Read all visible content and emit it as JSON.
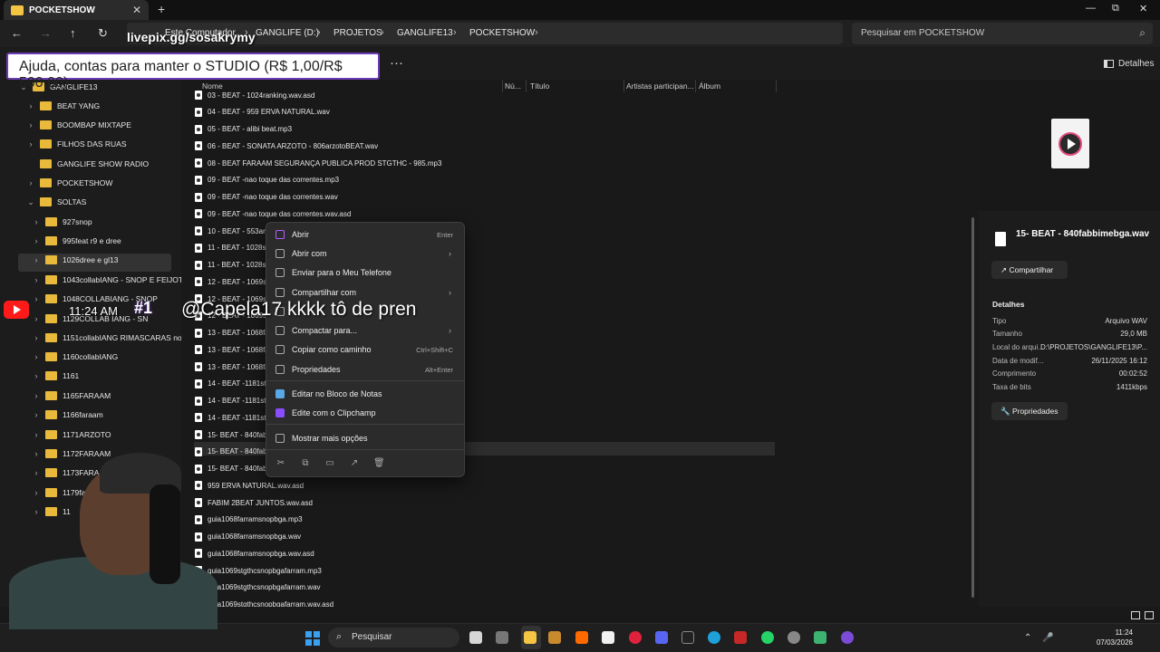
{
  "window": {
    "tab_title": "POCKETSHOW",
    "tab_close": "✕",
    "new_tab": "+",
    "minimize": "—",
    "maximize": "⧉",
    "close": "✕"
  },
  "nav": {
    "back": "←",
    "forward": "→",
    "up": "↑",
    "refresh": "↻"
  },
  "breadcrumbs": [
    "Este Computador",
    "GANGLIFE (D:)",
    "PROJETOS",
    "GANGLIFE13",
    "POCKETSHOW"
  ],
  "search": {
    "placeholder": "Pesquisar em POCKETSHOW",
    "icon": "search-icon"
  },
  "toolbar": {
    "more": "···",
    "details_label": "Detalhes"
  },
  "overlay": {
    "pix": "livepix.gg/sosakrymy",
    "donation": "Ajuda, contas para manter o STUDIO (R$ 1,00/R$ 500,00)",
    "chat_time": "11:24 AM",
    "chat_rank": "#1",
    "chat_message": "@Capela17 kkkk tô de pren"
  },
  "sidebar": {
    "items": [
      {
        "label": "GANGLIFE13",
        "chev": "⌄"
      },
      {
        "label": "BEAT YANG",
        "chev": "›"
      },
      {
        "label": "BOOMBAP MIXTAPE",
        "chev": "›"
      },
      {
        "label": "FILHOS DAS RUAS",
        "chev": "›"
      },
      {
        "label": "GANGLIFE SHOW RADIO",
        "chev": ""
      },
      {
        "label": "POCKETSHOW",
        "chev": "›"
      },
      {
        "label": "SOLTAS",
        "chev": "⌄"
      },
      {
        "label": "927snop",
        "chev": "›"
      },
      {
        "label": "995feat r9 e dree",
        "chev": "›"
      },
      {
        "label": "1026dree e gl13",
        "chev": "›"
      },
      {
        "label": "1043collabIANG - SNOP E FEIJOTA",
        "chev": "›"
      },
      {
        "label": "1048COLLABIANG - SNOP",
        "chev": "›"
      },
      {
        "label": "1129COLLAB IANG - SN",
        "chev": "›"
      },
      {
        "label": "1151collabIANG RIMASCARAS nofac",
        "chev": "›"
      },
      {
        "label": "1160collabIANG",
        "chev": "›"
      },
      {
        "label": "1161",
        "chev": "›"
      },
      {
        "label": "1165FARAAM",
        "chev": "›"
      },
      {
        "label": "1166faraam",
        "chev": "›"
      },
      {
        "label": "1171ARZOTO",
        "chev": "›"
      },
      {
        "label": "1172FARAAM",
        "chev": "›"
      },
      {
        "label": "1173FARAAMXF",
        "chev": "›"
      },
      {
        "label": "1179farr",
        "chev": "›"
      },
      {
        "label": "11",
        "chev": "›"
      }
    ]
  },
  "columns": [
    "Nome",
    "Nú...",
    "Título",
    "Artistas participan...",
    "Álbum"
  ],
  "files": [
    "03 - BEAT - 1024ranking.wav.asd",
    "04 - BEAT - 959 ERVA NATURAL.wav",
    "05 - BEAT - alibi beat.mp3",
    "06 - BEAT - SONATA ARZOTO - 806arzotoBEAT.wav",
    "08 - BEAT FARAAM SEGURANÇA PUBLICA PROD STGTHC - 985.mp3",
    "09 - BEAT -nao toque das correntes.mp3",
    "09 - BEAT -nao toque das correntes.wav",
    "09 - BEAT -nao toque das correntes.wav.asd",
    "10 - BEAT - 553arzo",
    "11 - BEAT - 1028sn",
    "11 - BEAT - 1028sn",
    "12 - BEAT - 1069stg",
    "12 - BEAT - 1069stg",
    "12 - BEAT - 1069stg",
    "13 - BEAT - 1068fari",
    "13 - BEAT - 1068fari",
    "13 - BEAT - 1068fari",
    "14 - BEAT -1181stg",
    "14 - BEAT -1181stg",
    "14 - BEAT -1181stg",
    "15- BEAT - 840fabb",
    "15- BEAT - 840fabb",
    "15- BEAT - 840fabb",
    "959 ERVA NATURAL.wav.asd",
    "FABIM 2BEAT JUNTOS.wav.asd",
    "guia1068farramsnopbga.mp3",
    "guia1068farramsnopbga.wav",
    "guia1068farramsnopbga.wav.asd",
    "guia1069stgthcsnopbgafarram.mp3",
    "guia1069stgthcsnopbgafarram.wav",
    "guia1069stgthcsnopbgafarram.wav.asd"
  ],
  "context_menu": {
    "items": [
      {
        "label": "Abrir",
        "shortcut": "Enter",
        "arrow": ""
      },
      {
        "label": "Abrir com",
        "shortcut": "",
        "arrow": "›"
      },
      {
        "label": "Enviar para o Meu Telefone",
        "shortcut": "",
        "arrow": ""
      },
      {
        "label": "Compartilhar com",
        "shortcut": "",
        "arrow": "›"
      },
      {
        "label": "",
        "shortcut": "",
        "arrow": ""
      },
      {
        "label": "Compactar para...",
        "shortcut": "",
        "arrow": "›"
      },
      {
        "label": "Copiar como caminho",
        "shortcut": "Ctrl+Shift+C",
        "arrow": ""
      },
      {
        "label": "Propriedades",
        "shortcut": "Alt+Enter",
        "arrow": ""
      },
      {
        "label": "Editar no Bloco de Notas",
        "shortcut": "",
        "arrow": ""
      },
      {
        "label": "Edite com o Clipchamp",
        "shortcut": "",
        "arrow": ""
      },
      {
        "label": "Mostrar mais opções",
        "shortcut": "",
        "arrow": ""
      }
    ],
    "actions": [
      "✂",
      "⧉",
      "▭",
      "↗",
      "🗑"
    ]
  },
  "details": {
    "filename": "15- BEAT - 840fabbimebga.wav",
    "share_label": "Compartilhar",
    "heading": "Detalhes",
    "rows": [
      {
        "key": "Tipo",
        "value": "Arquivo WAV"
      },
      {
        "key": "Tamanho",
        "value": "29,0 MB"
      },
      {
        "key": "Local do arqui...",
        "value": "D:\\PROJETOS\\GANGLIFE13\\P..."
      },
      {
        "key": "Data de modif...",
        "value": "26/11/2025 16:12"
      },
      {
        "key": "Comprimento",
        "value": "00:02:52"
      },
      {
        "key": "Taxa de bits",
        "value": "1411kbps"
      }
    ],
    "properties_label": "Propriedades"
  },
  "taskbar": {
    "search_placeholder": "Pesquisar",
    "time": "11:24",
    "date": "07/03/2026",
    "tray_up": "⌃",
    "tray_mic": "🎤"
  },
  "colors": {
    "accent": "#3aa0f0",
    "folder": "#e8b93a",
    "donation_border": "#6c3db4",
    "youtube": "#ff1a1a"
  }
}
